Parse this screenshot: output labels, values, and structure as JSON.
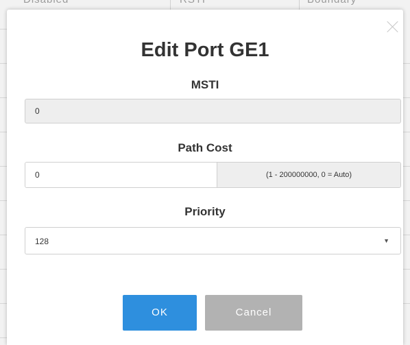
{
  "background_table": {
    "headers": [
      "Disabled",
      "RSTP",
      "Boundary"
    ]
  },
  "dialog": {
    "title": "Edit Port GE1",
    "msti": {
      "label": "MSTI",
      "value": "0"
    },
    "path_cost": {
      "label": "Path Cost",
      "value": "0",
      "hint": "(1 - 200000000, 0 = Auto)"
    },
    "priority": {
      "label": "Priority",
      "value": "128"
    },
    "ok_label": "OK",
    "cancel_label": "Cancel",
    "close_icon": "close-icon"
  },
  "colors": {
    "ok_button": "#2e8fde",
    "cancel_button": "#b2b2b2",
    "readonly_field": "#eeeeee"
  }
}
